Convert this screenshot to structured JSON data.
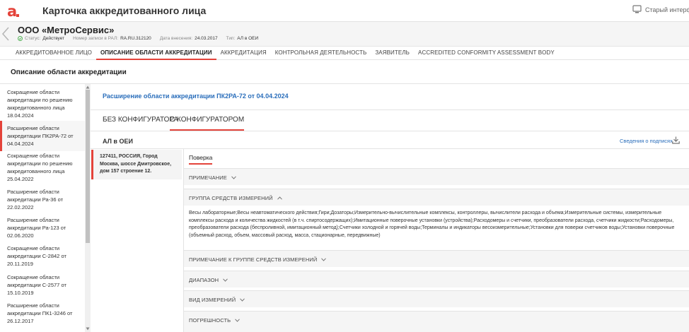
{
  "header": {
    "title": "Карточка аккредитованного лица",
    "old_ui_label": "Старый интерфейс"
  },
  "entity": {
    "name": "ООО «МетроСервис»",
    "status_label": "Статус:",
    "status_value": "Действует",
    "reg_label": "Номер записи в РАЛ:",
    "reg_value": "RA.RU.312120",
    "date_label": "Дата внесения:",
    "date_value": "24.03.2017",
    "type_label": "Тип:",
    "type_value": "АЛ в ОЕИ"
  },
  "tabs": [
    {
      "label": "АККРЕДИТОВАННОЕ ЛИЦО"
    },
    {
      "label": "ОПИСАНИЕ ОБЛАСТИ АККРЕДИТАЦИИ"
    },
    {
      "label": "АККРЕДИТАЦИЯ"
    },
    {
      "label": "КОНТРОЛЬНАЯ ДЕЯТЕЛЬНОСТЬ"
    },
    {
      "label": "ЗАЯВИТЕЛЬ"
    },
    {
      "label": "ACCREDITED CONFORMITY ASSESSMENT BODY"
    }
  ],
  "section_title": "Описание области аккредитации",
  "decisions": [
    {
      "label": "Сокращение области аккредитации по решению аккредитованного лица 18.04.2024"
    },
    {
      "label": "Расширение области аккредитации ПК2РА-72 от 04.04.2024"
    },
    {
      "label": "Сокращение области аккредитации по решению аккредитованного лица 25.04.2022"
    },
    {
      "label": "Расширение области аккредитации Ра-36 от 22.02.2022"
    },
    {
      "label": "Расширение области аккредитации Ра-123 от 02.06.2020"
    },
    {
      "label": "Сокращение области аккредитации С-2842 от 20.11.2019"
    },
    {
      "label": "Сокращение области аккредитации С-2577 от 15.10.2019"
    },
    {
      "label": "Расширение области аккредитации ПК1-3246 от 26.12.2017"
    }
  ],
  "content": {
    "title": "Расширение области аккредитации ПК2РА-72 от 04.04.2024",
    "cfg_tab_without": "БЕЗ КОНФИГУРАТОРА",
    "cfg_tab_with": "С КОНФИГУРАТОРОМ",
    "al_title": "АЛ в ОЕИ",
    "signatures_link": "Сведения о подписях",
    "address": "127411, РОССИЯ, Город Москва, шоссе Дмитровское, дом 157 строение 12.",
    "poverka_tab": "Поверка",
    "sections": {
      "note": "ПРИМЕЧАНИЕ",
      "group": "ГРУППА СРЕДСТВ ИЗМЕРЕНИЙ",
      "group_note": "ПРИМЕЧАНИЕ К ГРУППЕ СРЕДСТВ ИЗМЕРЕНИЙ",
      "range": "ДИАПАЗОН",
      "kind": "ВИД ИЗМЕРЕНИЙ",
      "error": "ПОГРЕШНОСТЬ"
    },
    "group_text": "Весы лабораторные;Весы неавтоматического действия;Гири;Дозаторы;Измерительно-вычислительные комплексы, контроллеры, вычислители расхода и объема;Измерительные системы, измерительные комплексы расхода и количества жидкостей (в т.ч. спиртосодержащих);Имитационные поверочные установки (устройства);Расходомеры и счетчики, преобразователи расхода, счетчики жидкости;Расходомеры, преобразователи расхода (беспроливной, имитационный метод);Счетчики холодной и горячей воды;Терминалы и индикаторы весоизмерительные;Установки для поверки счетчиков воды;Установки поверочные (объемный расход, объем, массовый расход, масса, стационарные, передвижные)"
  },
  "colors": {
    "accent": "#e4433a",
    "link": "#2a6ebb"
  }
}
